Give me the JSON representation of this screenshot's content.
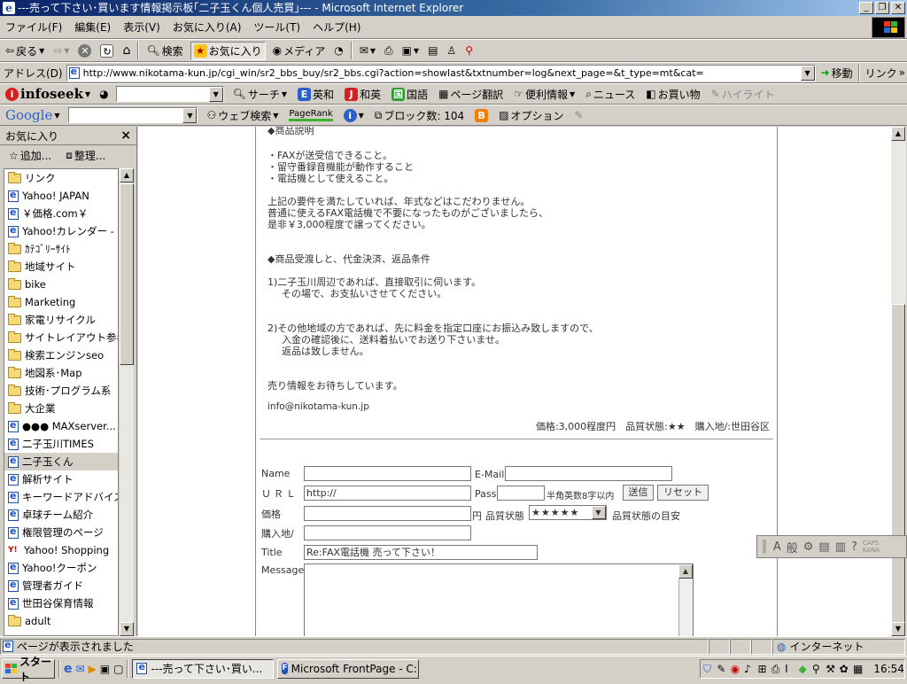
{
  "window": {
    "title": "---売って下さい･買います情報掲示板｢二子玉くん個人売買｣--- - Microsoft Internet Explorer"
  },
  "menu": [
    "ファイル(F)",
    "編集(E)",
    "表示(V)",
    "お気に入り(A)",
    "ツール(T)",
    "ヘルプ(H)"
  ],
  "toolbar": {
    "back": "戻る",
    "search": "検索",
    "favorites": "お気に入り",
    "media": "メディア"
  },
  "address": {
    "label": "アドレス(D)",
    "url": "http://www.nikotama-kun.jp/cgi_win/sr2_bbs_buy/sr2_bbs.cgi?action=showlast&txtnumber=log&next_page=&t_type=mt&cat=",
    "go": "移動",
    "links": "リンク"
  },
  "infoseek": {
    "brand": "infoseek",
    "search": "サーチ",
    "eiwa": "英和",
    "waei": "和英",
    "kokugo": "国語",
    "translate": "ページ翻訳",
    "benri": "便利情報",
    "news": "ニュース",
    "shopping": "お買い物",
    "highlight": "ハイライト"
  },
  "google": {
    "brand": "Google",
    "web_search": "ウェブ検索",
    "pagerank": "PageRank",
    "block_count": "ブロック数: 104",
    "options": "オプション"
  },
  "sidebar": {
    "title": "お気に入り",
    "close": "×",
    "add": "追加...",
    "organize": "整理...",
    "items": [
      {
        "label": "リンク",
        "type": "folder"
      },
      {
        "label": "Yahoo! JAPAN",
        "type": "page"
      },
      {
        "label": "￥価格.com￥",
        "type": "page"
      },
      {
        "label": "Yahoo!カレンダー - ...",
        "type": "page"
      },
      {
        "label": "ｶﾃｺﾞﾘｰｻｲﾄ",
        "type": "folder"
      },
      {
        "label": "地域サイト",
        "type": "folder"
      },
      {
        "label": "bike",
        "type": "folder"
      },
      {
        "label": "Marketing",
        "type": "folder"
      },
      {
        "label": "家電リサイクル",
        "type": "folder"
      },
      {
        "label": "サイトレイアウト参考",
        "type": "folder"
      },
      {
        "label": "検索エンジンseo",
        "type": "folder"
      },
      {
        "label": "地図系･Map",
        "type": "folder"
      },
      {
        "label": "技術･プログラム系",
        "type": "folder"
      },
      {
        "label": "大企業",
        "type": "folder"
      },
      {
        "label": "●●● MAXserver...",
        "type": "page"
      },
      {
        "label": "二子玉川TIMES",
        "type": "page"
      },
      {
        "label": "二子玉くん",
        "type": "page",
        "selected": true
      },
      {
        "label": "解析サイト",
        "type": "page"
      },
      {
        "label": "キーワードアドバイス",
        "type": "page"
      },
      {
        "label": "卓球チーム紹介",
        "type": "page"
      },
      {
        "label": "権限管理のページ",
        "type": "page"
      },
      {
        "label": "Yahoo! Shopping",
        "type": "yahoo"
      },
      {
        "label": "Yahoo!クーポン",
        "type": "page"
      },
      {
        "label": "管理者ガイド",
        "type": "page"
      },
      {
        "label": "世田谷保育情報",
        "type": "page"
      },
      {
        "label": "adult",
        "type": "folder"
      }
    ]
  },
  "post": {
    "heading_partial": "◆商品説明",
    "req1": "・FAXが送受信できること。",
    "req2": "・留守番録音機能が動作すること",
    "req3": "・電話機として使えること。",
    "p1": "上記の要件を満たしていれば、年式などはこだわりません。",
    "p2": "普通に使えるFAX電話機で不要になったものがございましたら、",
    "p3": "是非￥3,000程度で譲ってください。",
    "heading2": "◆商品受渡しと、代金決済、返品条件",
    "c1a": "1)二子玉川周辺であれば、直接取引に伺います。",
    "c1b": "その場で、お支払いさせてください。",
    "c2a": "2)その他地域の方であれば、先に料金を指定口座にお振込み致しますので、",
    "c2b": "入金の確認後に、送料着払いでお送り下さいませ。",
    "c2c": "返品は致しません。",
    "closing": "売り情報をお待ちしています。",
    "email": "info@nikotama-kun.jp",
    "meta": "価格:3,000程度円　品質状態:★★　購入地/:世田谷区"
  },
  "form": {
    "name_label": "Name",
    "email_label": "E-Mail",
    "url_label": "ＵＲＬ",
    "url_value": "http://",
    "pass_label": "Pass",
    "pass_hint": "半角英数8字以内",
    "send": "送信",
    "reset": "リセット",
    "price_label": "価格",
    "yen": "円",
    "quality_label": "品質状態",
    "quality_value": "★★★★★",
    "quality_guide": "品質状態の目安",
    "place_label": "購入地/",
    "title_label": "Title",
    "title_value": "Re:FAX電話機 売って下さい！",
    "message_label": "Message"
  },
  "ime": {
    "a": "A",
    "han": "般",
    "caps": "CAPS",
    "kana": "KANA"
  },
  "status": {
    "text": "ページが表示されました",
    "zone": "インターネット"
  },
  "taskbar": {
    "start": "スタート",
    "task1": "---売って下さい･買い...",
    "task2": "Microsoft FrontPage - C:...",
    "clock": "16:54"
  },
  "colors": {
    "title_start": "#0a246a",
    "title_end": "#a6caf0",
    "chrome": "#d4d0c8"
  }
}
